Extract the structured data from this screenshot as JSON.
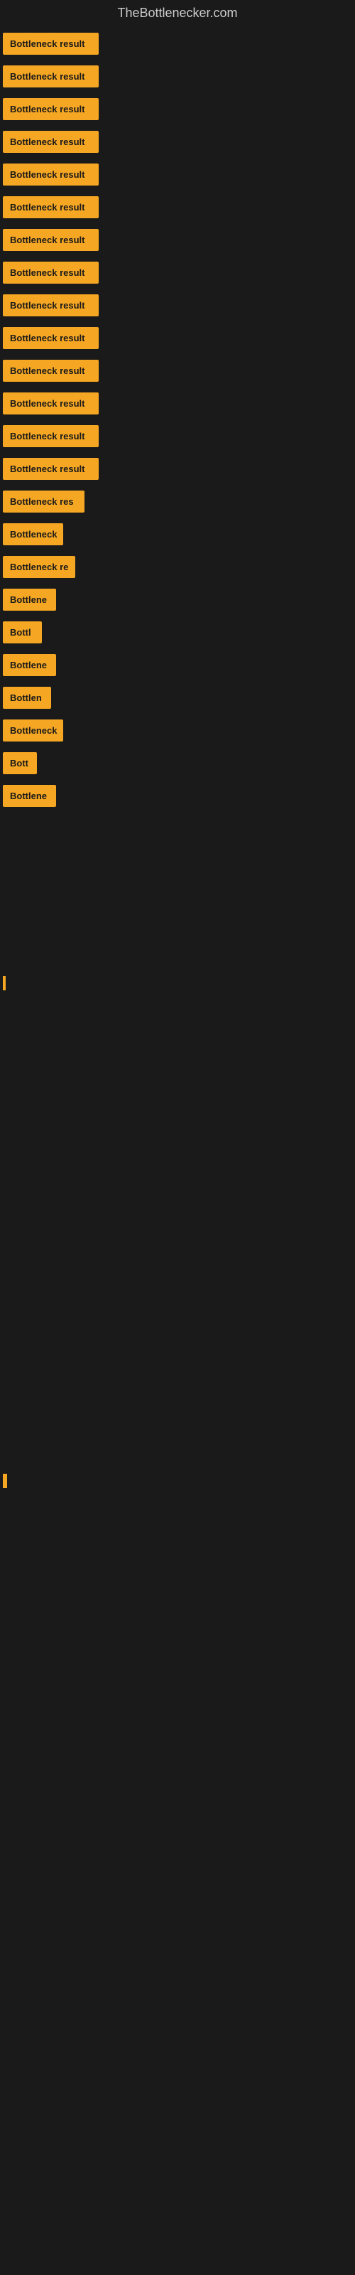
{
  "site": {
    "title": "TheBottlenecker.com"
  },
  "items": [
    {
      "id": 1,
      "label": "Bottleneck result",
      "width": 135
    },
    {
      "id": 2,
      "label": "Bottleneck result",
      "width": 135
    },
    {
      "id": 3,
      "label": "Bottleneck result",
      "width": 135
    },
    {
      "id": 4,
      "label": "Bottleneck result",
      "width": 135
    },
    {
      "id": 5,
      "label": "Bottleneck result",
      "width": 135
    },
    {
      "id": 6,
      "label": "Bottleneck result",
      "width": 135
    },
    {
      "id": 7,
      "label": "Bottleneck result",
      "width": 135
    },
    {
      "id": 8,
      "label": "Bottleneck result",
      "width": 135
    },
    {
      "id": 9,
      "label": "Bottleneck result",
      "width": 135
    },
    {
      "id": 10,
      "label": "Bottleneck result",
      "width": 135
    },
    {
      "id": 11,
      "label": "Bottleneck result",
      "width": 135
    },
    {
      "id": 12,
      "label": "Bottleneck result",
      "width": 135
    },
    {
      "id": 13,
      "label": "Bottleneck result",
      "width": 135
    },
    {
      "id": 14,
      "label": "Bottleneck result",
      "width": 135
    },
    {
      "id": 15,
      "label": "Bottleneck res",
      "width": 115
    },
    {
      "id": 16,
      "label": "Bottleneck",
      "width": 85
    },
    {
      "id": 17,
      "label": "Bottleneck re",
      "width": 102
    },
    {
      "id": 18,
      "label": "Bottlene",
      "width": 75
    },
    {
      "id": 19,
      "label": "Bottl",
      "width": 55
    },
    {
      "id": 20,
      "label": "Bottlene",
      "width": 75
    },
    {
      "id": 21,
      "label": "Bottlen",
      "width": 68
    },
    {
      "id": 22,
      "label": "Bottleneck",
      "width": 85
    },
    {
      "id": 23,
      "label": "Bott",
      "width": 48
    },
    {
      "id": 24,
      "label": "Bottlene",
      "width": 75
    }
  ],
  "colors": {
    "background": "#1a1a1a",
    "badge": "#f5a623",
    "title": "#cccccc",
    "badge_text": "#1a1a1a"
  }
}
